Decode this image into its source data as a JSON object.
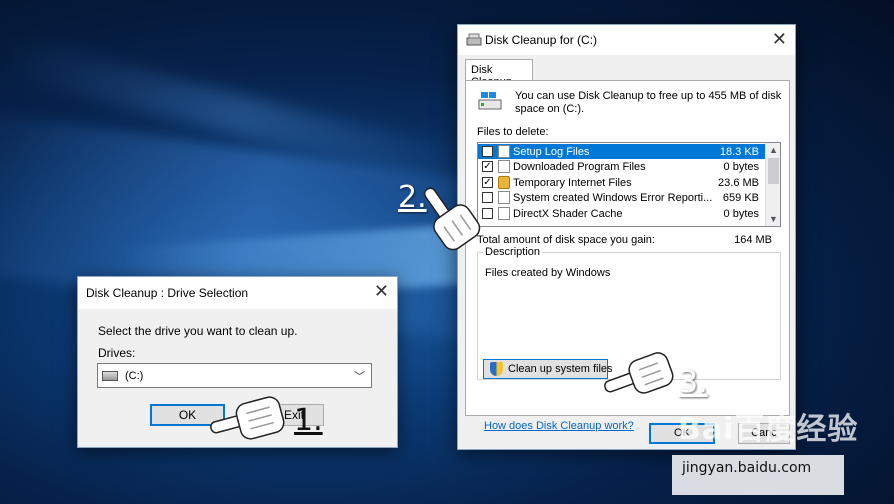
{
  "main_window": {
    "title": "Disk Cleanup for  (C:)",
    "tab": "Disk Cleanup",
    "info_text": "You can use Disk Cleanup to free up to 455 MB of disk space on  (C:).",
    "files_to_delete_label": "Files to delete:",
    "files": [
      {
        "name": "Setup Log Files",
        "size": "18.3 KB",
        "checked": false,
        "selected": true
      },
      {
        "name": "Downloaded Program Files",
        "size": "0 bytes",
        "checked": true,
        "selected": false
      },
      {
        "name": "Temporary Internet Files",
        "size": "23.6 MB",
        "checked": true,
        "selected": false
      },
      {
        "name": "System created Windows Error Reporti...",
        "size": "659 KB",
        "checked": false,
        "selected": false
      },
      {
        "name": "DirectX Shader Cache",
        "size": "0 bytes",
        "checked": false,
        "selected": false
      }
    ],
    "total_label": "Total amount of disk space you gain:",
    "total_value": "164 MB",
    "description_label": "Description",
    "description_text": "Files created by Windows",
    "cleanup_system_button": "Clean up system files",
    "how_link": "How does Disk Cleanup work?",
    "ok_button": "OK",
    "cancel_button": "Canc"
  },
  "drive_dialog": {
    "title": "Disk Cleanup : Drive Selection",
    "prompt": "Select the drive you want to clean up.",
    "drives_label": "Drives:",
    "selected_drive": "(C:)",
    "ok_button": "OK",
    "exit_button": "Exit"
  },
  "steps": {
    "one": "1.",
    "two": "2.",
    "three": "3."
  },
  "watermark": {
    "logo": "Bai百度经验",
    "url": "jingyan.baidu.com"
  }
}
